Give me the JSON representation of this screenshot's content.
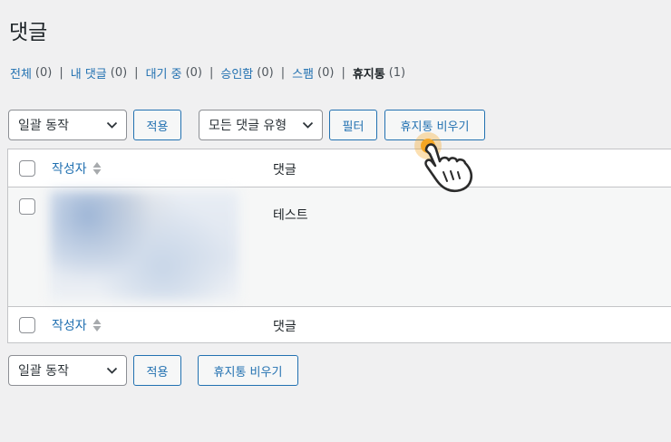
{
  "page": {
    "title": "댓글"
  },
  "filters": [
    {
      "label": "전체",
      "count": "(0)"
    },
    {
      "label": "내 댓글",
      "count": "(0)"
    },
    {
      "label": "대기 중",
      "count": "(0)"
    },
    {
      "label": "승인함",
      "count": "(0)"
    },
    {
      "label": "스팸",
      "count": "(0)"
    },
    {
      "label": "휴지통",
      "count": "(1)",
      "current": true
    }
  ],
  "top_nav": {
    "bulk_action": "일괄 동작",
    "apply": "적용",
    "comment_type": "모든 댓글 유형",
    "filter": "필터",
    "empty_trash": "휴지통 비우기"
  },
  "table": {
    "col_author": "작성자",
    "col_comment": "댓글",
    "rows": [
      {
        "comment": "테스트"
      }
    ]
  },
  "bottom_nav": {
    "bulk_action": "일괄 동작",
    "apply": "적용",
    "empty_trash": "휴지통 비우기"
  },
  "colors": {
    "link": "#2271b1",
    "background": "#f0f0f1",
    "cursor_highlight": "#f5a623"
  }
}
